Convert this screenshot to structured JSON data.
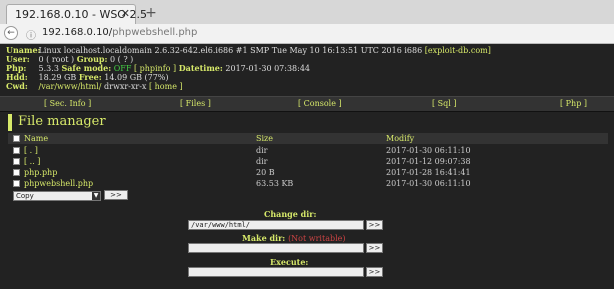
{
  "browser": {
    "tab_title": "192.168.0.10 - WSO 2.5",
    "tab_close": "✕",
    "new_tab": "+",
    "url_host": "192.168.0.10/",
    "url_path": "phpwebshell.php",
    "back_icon": "←",
    "info_icon": "ⓘ"
  },
  "sysinfo": {
    "uname_label": "Uname:",
    "uname_value": "Linux localhost.localdomain 2.6.32-642.el6.i686 #1 SMP Tue May 10 16:13:51 UTC 2016 i686",
    "uname_link": "[exploit-db.com]",
    "user_label": "User:",
    "user_value": "0 ( root ) ",
    "group_label": "Group:",
    "group_value": " 0 ( ? )",
    "php_label": "Php:",
    "php_version": "5.3.3 ",
    "safe_mode_label": "Safe mode:",
    "safe_mode_value": "OFF",
    "phpinfo_link": "[ phpinfo ]",
    "datetime_label": "Datetime:",
    "datetime_value": "2017-01-30 07:38:44",
    "hdd_label": "Hdd:",
    "hdd_value": "18.29 GB ",
    "free_label": "Free:",
    "free_value": "14.09 GB (77%)",
    "cwd_label": "Cwd:",
    "cwd_value": "/var/www/html/",
    "cwd_perm": " drwxr-xr-x ",
    "home_link": "[ home ]"
  },
  "menu": {
    "items": [
      "[ Sec. Info ]",
      "[ Files ]",
      "[ Console ]",
      "[ Sql ]",
      "[ Php ]"
    ]
  },
  "file_manager": {
    "title": "File manager",
    "headers": {
      "name": "Name",
      "size": "Size",
      "modify": "Modify"
    },
    "rows": [
      {
        "name": "[ . ]",
        "size": "dir",
        "modify": "2017-01-30 06:11:10"
      },
      {
        "name": "[ .. ]",
        "size": "dir",
        "modify": "2017-01-12 09:07:38"
      },
      {
        "name": "php.php",
        "size": "20 B",
        "modify": "2017-01-28 16:41:41"
      },
      {
        "name": "phpwebshell.php",
        "size": "63.53 KB",
        "modify": "2017-01-30 06:11:10"
      }
    ],
    "action_select": "Copy",
    "action_button": ">>"
  },
  "forms": {
    "change_dir_label": "Change dir:",
    "change_dir_value": "/var/www/html/",
    "make_dir_label": "Make dir:",
    "make_dir_note": "(Not writable)",
    "execute_label": "Execute:",
    "go_label": ">>"
  }
}
